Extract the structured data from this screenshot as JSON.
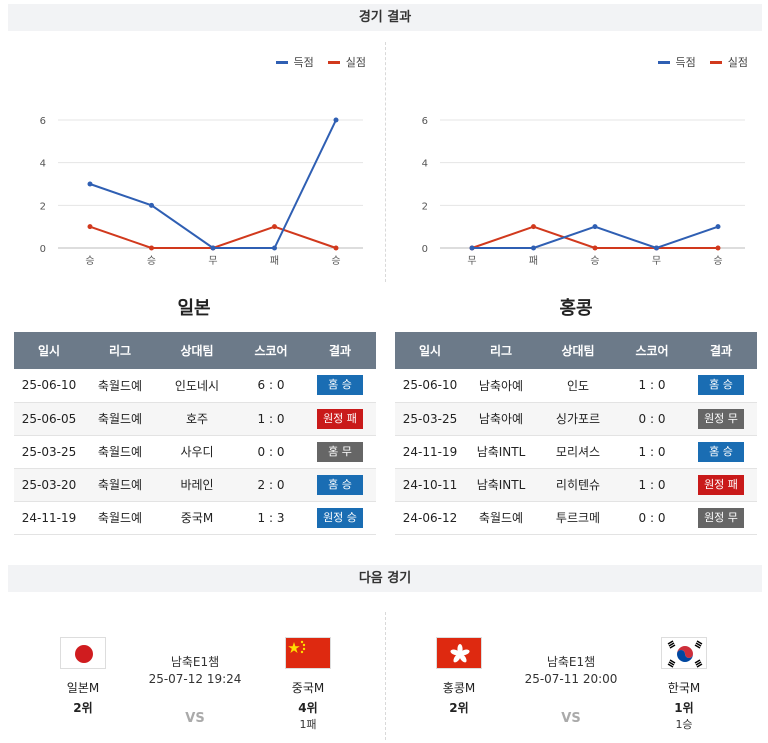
{
  "header": {
    "title": "경기 결과"
  },
  "legend": {
    "scored": "득점",
    "conceded": "실점"
  },
  "colors": {
    "scored": "#2f5fb3",
    "conceded": "#d1391d",
    "home_win": "#1a6db3",
    "away_win": "#1a6db3",
    "loss": "#c91a1a",
    "draw": "#666666"
  },
  "chart_data": [
    {
      "type": "line",
      "team": "일본",
      "categories": [
        "승",
        "승",
        "무",
        "패",
        "승"
      ],
      "yticks": [
        0,
        2,
        4,
        6
      ],
      "ylim": [
        0,
        6
      ],
      "series": [
        {
          "name": "득점",
          "values": [
            3,
            2,
            0,
            0,
            6
          ]
        },
        {
          "name": "실점",
          "values": [
            1,
            0,
            0,
            1,
            0
          ]
        }
      ]
    },
    {
      "type": "line",
      "team": "홍콩",
      "categories": [
        "무",
        "패",
        "승",
        "무",
        "승"
      ],
      "yticks": [
        0,
        2,
        4,
        6
      ],
      "ylim": [
        0,
        6
      ],
      "series": [
        {
          "name": "득점",
          "values": [
            0,
            0,
            1,
            0,
            1
          ]
        },
        {
          "name": "실점",
          "values": [
            0,
            1,
            0,
            0,
            0
          ]
        }
      ]
    }
  ],
  "tables": {
    "columns": [
      "일시",
      "리그",
      "상대팀",
      "스코어",
      "결과"
    ],
    "left": {
      "team": "일본",
      "rows": [
        {
          "date": "25-06-10",
          "league": "축월드예",
          "opponent": "인도네시",
          "score": "6 : 0",
          "result": "홈 승",
          "kind": "win"
        },
        {
          "date": "25-06-05",
          "league": "축월드예",
          "opponent": "호주",
          "score": "1 : 0",
          "result": "원정 패",
          "kind": "loss"
        },
        {
          "date": "25-03-25",
          "league": "축월드예",
          "opponent": "사우디",
          "score": "0 : 0",
          "result": "홈 무",
          "kind": "draw"
        },
        {
          "date": "25-03-20",
          "league": "축월드예",
          "opponent": "바레인",
          "score": "2 : 0",
          "result": "홈 승",
          "kind": "win"
        },
        {
          "date": "24-11-19",
          "league": "축월드예",
          "opponent": "중국M",
          "score": "1 : 3",
          "result": "원정 승",
          "kind": "win"
        }
      ]
    },
    "right": {
      "team": "홍콩",
      "rows": [
        {
          "date": "25-06-10",
          "league": "남축아예",
          "opponent": "인도",
          "score": "1 : 0",
          "result": "홈 승",
          "kind": "win"
        },
        {
          "date": "25-03-25",
          "league": "남축아예",
          "opponent": "싱가포르",
          "score": "0 : 0",
          "result": "원정 무",
          "kind": "draw"
        },
        {
          "date": "24-11-19",
          "league": "남축INTL",
          "opponent": "모리셔스",
          "score": "1 : 0",
          "result": "홈 승",
          "kind": "win"
        },
        {
          "date": "24-10-11",
          "league": "남축INTL",
          "opponent": "리히텐슈",
          "score": "1 : 0",
          "result": "원정 패",
          "kind": "loss"
        },
        {
          "date": "24-06-12",
          "league": "축월드예",
          "opponent": "투르크메",
          "score": "0 : 0",
          "result": "원정 무",
          "kind": "draw"
        }
      ]
    }
  },
  "next": {
    "title": "다음 경기",
    "matches": [
      {
        "league": "남축E1챔",
        "time": "25-07-12 19:24",
        "vs": "VS",
        "home": {
          "name": "일본M",
          "rank": "2위",
          "extra": "",
          "flag": "japan"
        },
        "away": {
          "name": "중국M",
          "rank": "4위",
          "extra": "1패",
          "flag": "china"
        }
      },
      {
        "league": "남축E1챔",
        "time": "25-07-11 20:00",
        "vs": "VS",
        "home": {
          "name": "홍콩M",
          "rank": "2위",
          "extra": "",
          "flag": "hongkong"
        },
        "away": {
          "name": "한국M",
          "rank": "1위",
          "extra": "1승",
          "flag": "korea"
        }
      }
    ]
  }
}
